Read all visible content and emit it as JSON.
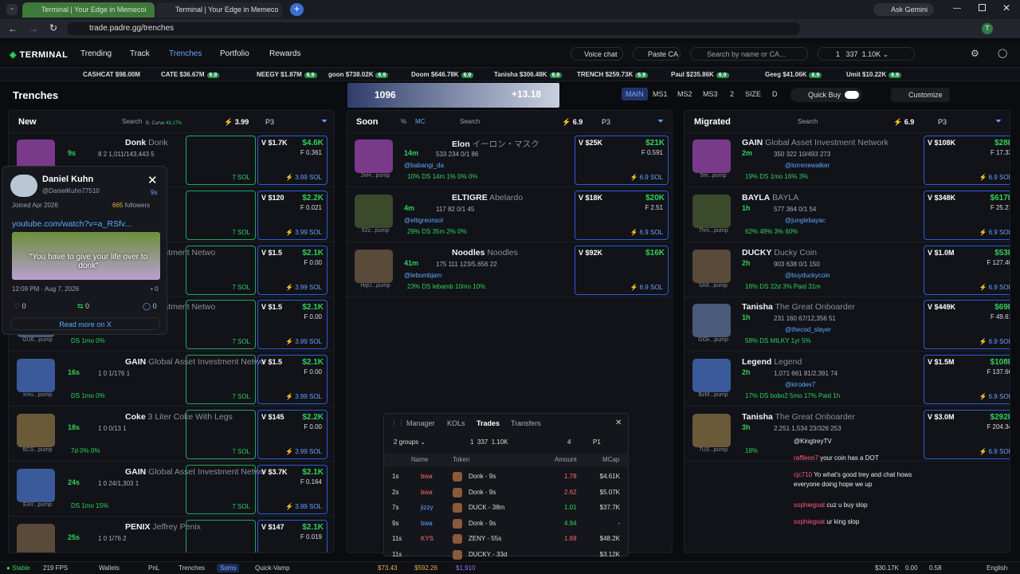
{
  "browser": {
    "tab1": "Terminal | Your Edge in Memecoi",
    "tab2": "Terminal | Your Edge in Memeco",
    "url": "trade.padre.gg/trenches",
    "gemini": "Ask Gemini"
  },
  "nav": {
    "logo": "TERMINAL",
    "links": [
      "Trending",
      "Track",
      "Trenches",
      "Portfolio",
      "Rewards"
    ],
    "voice": "Voice chat",
    "paste": "Paste CA",
    "search_ph": "Search by name or CA...",
    "slash": "/",
    "w_count": "1",
    "w_val": "337",
    "w_bal": "1.10K"
  },
  "ticker": [
    {
      "name": "CASHCAT",
      "mc": "$98.00M"
    },
    {
      "name": "CATE",
      "mc": "$36.67M",
      "p": "6.9"
    },
    {
      "name": "NEEGY",
      "mc": "$1.87M",
      "p": "6.9"
    },
    {
      "name": "goon",
      "mc": "$738.02K",
      "p": "6.9"
    },
    {
      "name": "Doom",
      "mc": "$646.78K",
      "p": "6.9"
    },
    {
      "name": "Tanisha",
      "mc": "$306.48K",
      "p": "6.9"
    },
    {
      "name": "TRENCH",
      "mc": "$259.73K",
      "p": "6.9"
    },
    {
      "name": "Paul",
      "mc": "$235.86K",
      "p": "6.9"
    },
    {
      "name": "Geeg",
      "mc": "$41.06K",
      "p": "6.9"
    },
    {
      "name": "Umit",
      "mc": "$10.22K",
      "p": "6.9"
    }
  ],
  "page": {
    "title": "Trenches",
    "banner_val": "1096",
    "banner_pct": "+13.18",
    "tabs": [
      "MAIN",
      "MS1",
      "MS2",
      "MS3",
      "2",
      "SIZE",
      "D"
    ],
    "quickbuy": "Quick Buy",
    "customize": "Customize"
  },
  "cols": {
    "new": {
      "title": "New",
      "search": "Search",
      "curve": "B. Curve",
      "curve_pct": "43.17%",
      "amt": "3.99",
      "p": "P3"
    },
    "soon": {
      "title": "Soon",
      "pct": "%",
      "mc": "MC",
      "search": "Search",
      "amt": "6.9",
      "p": "P3"
    },
    "migrated": {
      "title": "Migrated",
      "search": "Search",
      "amt": "6.9",
      "p": "P3"
    }
  },
  "new_cards": [
    {
      "name": "Donk",
      "alt": "Donk",
      "age": "9s",
      "sub": "",
      "v": "$1.7K",
      "mc": "$4.6K",
      "f": "0.361",
      "sol": "3.99 SOL",
      "stats": "8  2  1,011/143,443  5",
      "pct": "0%   0%   0%"
    },
    {
      "name": "",
      "alt": "",
      "age": "",
      "sub": "",
      "v": "$120",
      "mc": "$2.2K",
      "f": "0.021",
      "sol": "3.99 SOL",
      "stats": "0/1  2",
      "pct": "0%   0%"
    },
    {
      "name": "",
      "alt": "Asset Investment Netwo",
      "age": "",
      "sub": "",
      "v": "$1.5",
      "mc": "$2.1K",
      "f": "0.00",
      "sol": "3.99 SOL",
      "stats": "0  1/176  1",
      "pct": "0%   0%"
    },
    {
      "name": "",
      "alt": "Asset Investment Netwo",
      "age": "",
      "sub": "GU6...pump",
      "v": "$1.5",
      "mc": "$2.1K",
      "f": "0.00",
      "sol": "3.99 SOL",
      "stats": "0  1/176  0",
      "pct": "DS  1mo   0%"
    },
    {
      "name": "GAIN",
      "alt": "Global Asset Investment Netwo",
      "age": "16s",
      "sub": "xmu...pump",
      "v": "$1.5",
      "mc": "$2.1K",
      "f": "0.00",
      "sol": "3.99 SOL",
      "stats": "1  0  1/176  1",
      "pct": "DS  1mo   0%"
    },
    {
      "name": "Coke",
      "alt": "3 Liter Coke With Legs",
      "age": "18s",
      "sub": "6CS...pump",
      "v": "$145",
      "mc": "$2.2K",
      "f": "0.00",
      "sol": "3.99 SOL",
      "stats": "1  0  0/13  1",
      "pct": "7d   0%   0%"
    },
    {
      "name": "GAIN",
      "alt": "Global Asset Investment Netwo",
      "age": "24s",
      "sub": "EAY...pump",
      "v": "$3.7K",
      "mc": "$2.1K",
      "f": "0.164",
      "sol": "3.99 SOL",
      "stats": "1  0  24/1,303  1",
      "pct": "DS  1mo   15%"
    },
    {
      "name": "PENIX",
      "alt": "Jeffrey Penix",
      "age": "25s",
      "sub": "",
      "v": "$147",
      "mc": "$2.1K",
      "f": "0.019",
      "sol": "",
      "stats": "1  0  1/76  2",
      "pct": ""
    }
  ],
  "soon_cards": [
    {
      "name": "Elon",
      "alt": "イーロン・マスク",
      "age": "14m",
      "sub": "2eH...pump",
      "user": "@babangi_da",
      "v": "$25K",
      "mc": "$21K",
      "f": "0.591",
      "sol": "6.9 SOL",
      "stats": "533  234  0/1  86",
      "pct": "10%   DS 14m   1%   0%   0%"
    },
    {
      "name": "ELTIGRE",
      "alt": "Abelardo",
      "age": "4m",
      "sub": "92z...pump",
      "user": "@eltigreonsol",
      "v": "$18K",
      "mc": "$20K",
      "f": "2.51",
      "sol": "6.9 SOL",
      "stats": "117  82  0/1  45",
      "pct": "29%   DS 35m   2%   0%"
    },
    {
      "name": "Noodles",
      "alt": "Noodles",
      "age": "41m",
      "sub": "HqU...pump",
      "user": "@lebombjam",
      "v": "$92K",
      "mc": "$16K",
      "f": "",
      "sol": "6.9 SOL",
      "stats": "175  111  123/5,656  22",
      "pct": "23%   DS lebamb 10mo   10%"
    }
  ],
  "mig_cards": [
    {
      "name": "GAIN",
      "alt": "Global Asset Investment Network",
      "age": "2m",
      "sub": "5ht...pump",
      "user": "@lorrenewalker",
      "v": "$108K",
      "mc": "$28K",
      "f": "17.33",
      "sol": "6.9 SOL",
      "stats": "350  322  10/493  273",
      "pct": "19%   DS 1mo   16%   3%"
    },
    {
      "name": "BAYLA",
      "alt": "BAYLA",
      "age": "1h",
      "sub": "7hm...pump",
      "user": "@junglebayac",
      "v": "$348K",
      "mc": "$617K",
      "f": "25.21",
      "sol": "6.9 SOL",
      "stats": "577  364  0/1  54",
      "pct": "62%   49%   3%   60%"
    },
    {
      "name": "DUCKY",
      "alt": "Ducky Coin",
      "age": "2h",
      "sub": "5A9...pump",
      "user": "@buyduckycoin",
      "v": "$1.0M",
      "mc": "$53K",
      "f": "127.40",
      "sol": "6.9 SOL",
      "stats": "903  638  0/1  150",
      "pct": "18%   DS 22d   3%   Paid 31m"
    },
    {
      "name": "Tanisha",
      "alt": "The Great Onboarder",
      "age": "1h",
      "sub": "GGk...pump",
      "user": "@thecod_slayer",
      "v": "$449K",
      "mc": "$69K",
      "f": "49.61",
      "sol": "6.9 SOL",
      "stats": "231  160  67/12,356  51",
      "pct": "58%   DS MILKY 1yr   5%"
    },
    {
      "name": "Legend",
      "alt": "Legend",
      "age": "2h",
      "sub": "BzM...pump",
      "user": "@kirodev7",
      "v": "$1.5M",
      "mc": "$108K",
      "f": "137.66",
      "sol": "6.9 SOL",
      "stats": "1,071  661  81/2,391  74",
      "pct": "17%   DS bobo2 5mo   17%   Paid 1h"
    },
    {
      "name": "Tanisha",
      "alt": "The Great Onboarder",
      "age": "3h",
      "sub": "7U3...pump",
      "user": "",
      "v": "$3.0M",
      "mc": "$292K",
      "f": "204.34",
      "sol": "6.9 SOL",
      "stats": "2,251  1,534  23/326  253",
      "pct": "18%"
    }
  ],
  "popup": {
    "name": "Daniel Kuhn",
    "handle": "@DanielKuhn77510",
    "age": "9s",
    "joined": "Joined Apr 2026",
    "followers": "665",
    "followers_lbl": "followers",
    "link": "youtube.com/watch?v=a_RSfv...",
    "caption": "\"You have to give your life over to donk\"",
    "time": "12:09 PM · Aug 7, 2026",
    "stats": [
      "0",
      "0",
      "0"
    ],
    "zero": "0",
    "more": "Read more on X"
  },
  "trades": {
    "tabs": [
      "Manager",
      "KOLs",
      "Trades",
      "Transfers"
    ],
    "groups": "2 groups",
    "w": "1",
    "wv": "337",
    "wb": "1.10K",
    "n": "4",
    "p": "P1",
    "head": [
      "Name",
      "Token",
      "Amount",
      "MCap"
    ],
    "rows": [
      {
        "t": "1s",
        "n": "bwa",
        "tok": "Donk - 9s",
        "amt": "1.78",
        "mc": "$4.61K",
        "red": true
      },
      {
        "t": "2s",
        "n": "bwa",
        "tok": "Donk - 9s",
        "amt": "2.62",
        "mc": "$5.07K",
        "red": true
      },
      {
        "t": "7s",
        "n": "jizzy",
        "tok": "DUCK - 38m",
        "amt": "1.01",
        "mc": "$37.7K",
        "red": false
      },
      {
        "t": "9s",
        "n": "bwa",
        "tok": "Donk - 9s",
        "amt": "4.94",
        "mc": "-",
        "red": false
      },
      {
        "t": "11s",
        "n": "KYS",
        "tok": "ZENY - 55s",
        "amt": "1.69",
        "mc": "$48.2K",
        "red": true
      },
      {
        "t": "11s",
        "n": "",
        "tok": "DUCKY - 33d",
        "amt": "",
        "mc": "$3.12K",
        "red": true
      }
    ]
  },
  "chat": [
    {
      "u": "",
      "m": "@KingtreyTV"
    },
    {
      "u": "raffleon7",
      "m": "your coin has a DOT"
    },
    {
      "u": "cjc710",
      "m": "Yo what's good trey and chat hows everyone doing hope we up"
    },
    {
      "u": "sophiegoat",
      "m": "cuz u buy slop"
    },
    {
      "u": "sophiegoat",
      "m": "ur king slop"
    }
  ],
  "footer": {
    "stable": "Stable",
    "fps": "219 FPS",
    "items": [
      "Wallets",
      "PnL",
      "Trenches",
      "Soms",
      "Quick-Vamp"
    ],
    "v1": "$73.43",
    "v2": "$592.26",
    "v3": "$1,910",
    "r1": "$30.17K",
    "r2": "0.00",
    "r3": "0.58",
    "lang": "English"
  }
}
